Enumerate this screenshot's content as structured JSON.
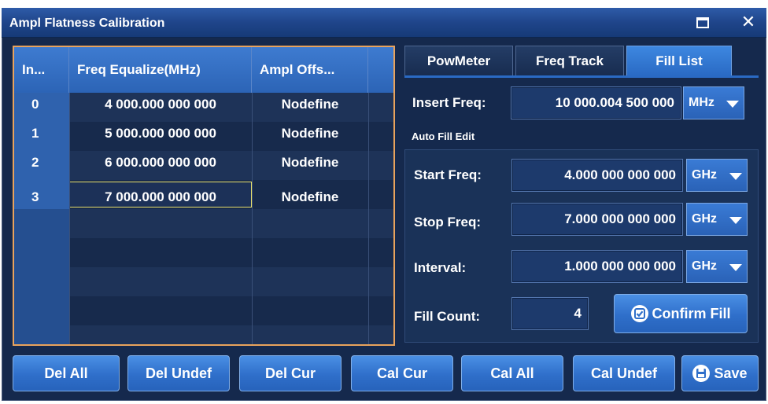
{
  "window": {
    "title": "Ampl Flatness Calibration"
  },
  "table": {
    "headers": [
      "In...",
      "Freq Equalize(MHz)",
      "Ampl Offs..."
    ],
    "rows": [
      {
        "index": "0",
        "freq": "4 000.000 000 000",
        "offset": "Nodefine"
      },
      {
        "index": "1",
        "freq": "5 000.000 000 000",
        "offset": "Nodefine"
      },
      {
        "index": "2",
        "freq": "6 000.000 000 000",
        "offset": "Nodefine"
      },
      {
        "index": "3",
        "freq": "7 000.000 000 000",
        "offset": "Nodefine"
      }
    ]
  },
  "tabs": [
    {
      "label": "PowMeter",
      "active": false
    },
    {
      "label": "Freq Track",
      "active": false
    },
    {
      "label": "Fill List",
      "active": true
    }
  ],
  "fill": {
    "insert_label": "Insert Freq:",
    "insert_value": "10 000.004 500 000",
    "insert_unit": "MHz",
    "auto_fill_title": "Auto Fill Edit",
    "start_label": "Start Freq:",
    "start_value": "4.000 000 000 000",
    "start_unit": "GHz",
    "stop_label": "Stop Freq:",
    "stop_value": "7.000 000 000 000",
    "stop_unit": "GHz",
    "interval_label": "Interval:",
    "interval_value": "1.000 000 000 000",
    "interval_unit": "GHz",
    "count_label": "Fill Count:",
    "count_value": "4",
    "confirm_label": "Confirm Fill"
  },
  "buttons": {
    "del_all": "Del All",
    "del_undef": "Del Undef",
    "del_cur": "Del Cur",
    "cal_cur": "Cal Cur",
    "cal_all": "Cal All",
    "cal_undef": "Cal Undef",
    "save": "Save"
  },
  "colors": {
    "accent": "#2f6fca",
    "panel": "#15294d",
    "selection": "#e8e06a",
    "table_border": "#e9a35c"
  }
}
